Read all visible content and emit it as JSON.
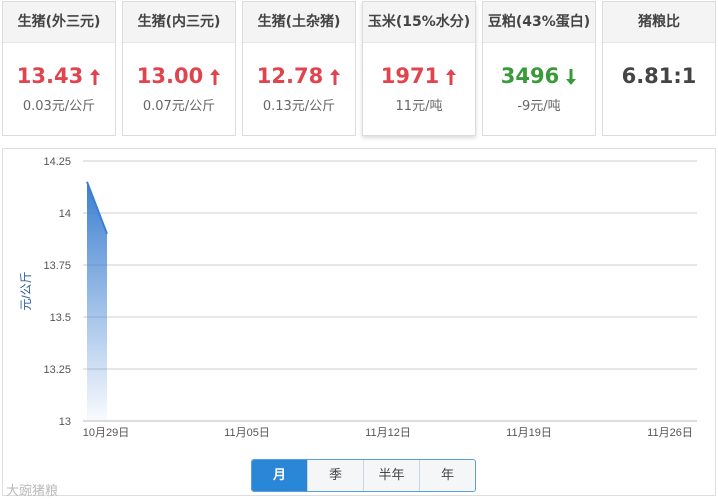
{
  "cards": [
    {
      "title": "生猪(外三元)",
      "value": "13.43",
      "change": "0.03元/公斤",
      "trend": "up"
    },
    {
      "title": "生猪(内三元)",
      "value": "13.00",
      "change": "0.07元/公斤",
      "trend": "up"
    },
    {
      "title": "生猪(土杂猪)",
      "value": "12.78",
      "change": "0.13元/公斤",
      "trend": "up"
    },
    {
      "title": "玉米(15%水分)",
      "value": "1971",
      "change": "11元/吨",
      "trend": "up"
    },
    {
      "title": "豆粕(43%蛋白)",
      "value": "3496",
      "change": "-9元/吨",
      "trend": "down"
    },
    {
      "title": "猪粮比",
      "value": "6.81:1",
      "change": "",
      "trend": "none"
    }
  ],
  "chart_data": {
    "type": "area",
    "ylabel": "元/公斤",
    "xlabel": "",
    "ylim": [
      13,
      14.25
    ],
    "yticks": [
      "14.25",
      "14",
      "13.75",
      "13.5",
      "13.25",
      "13"
    ],
    "xticks": [
      "10月29日",
      "11月05日",
      "11月12日",
      "11月19日",
      "11月26日"
    ],
    "x": [
      "10月28日",
      "10月29日"
    ],
    "values": [
      14.15,
      13.9
    ],
    "grid": true,
    "color": "#3b7fd1"
  },
  "range_buttons": [
    "月",
    "季",
    "半年",
    "年"
  ],
  "active_button": "月",
  "watermark": "大豌猪粮"
}
